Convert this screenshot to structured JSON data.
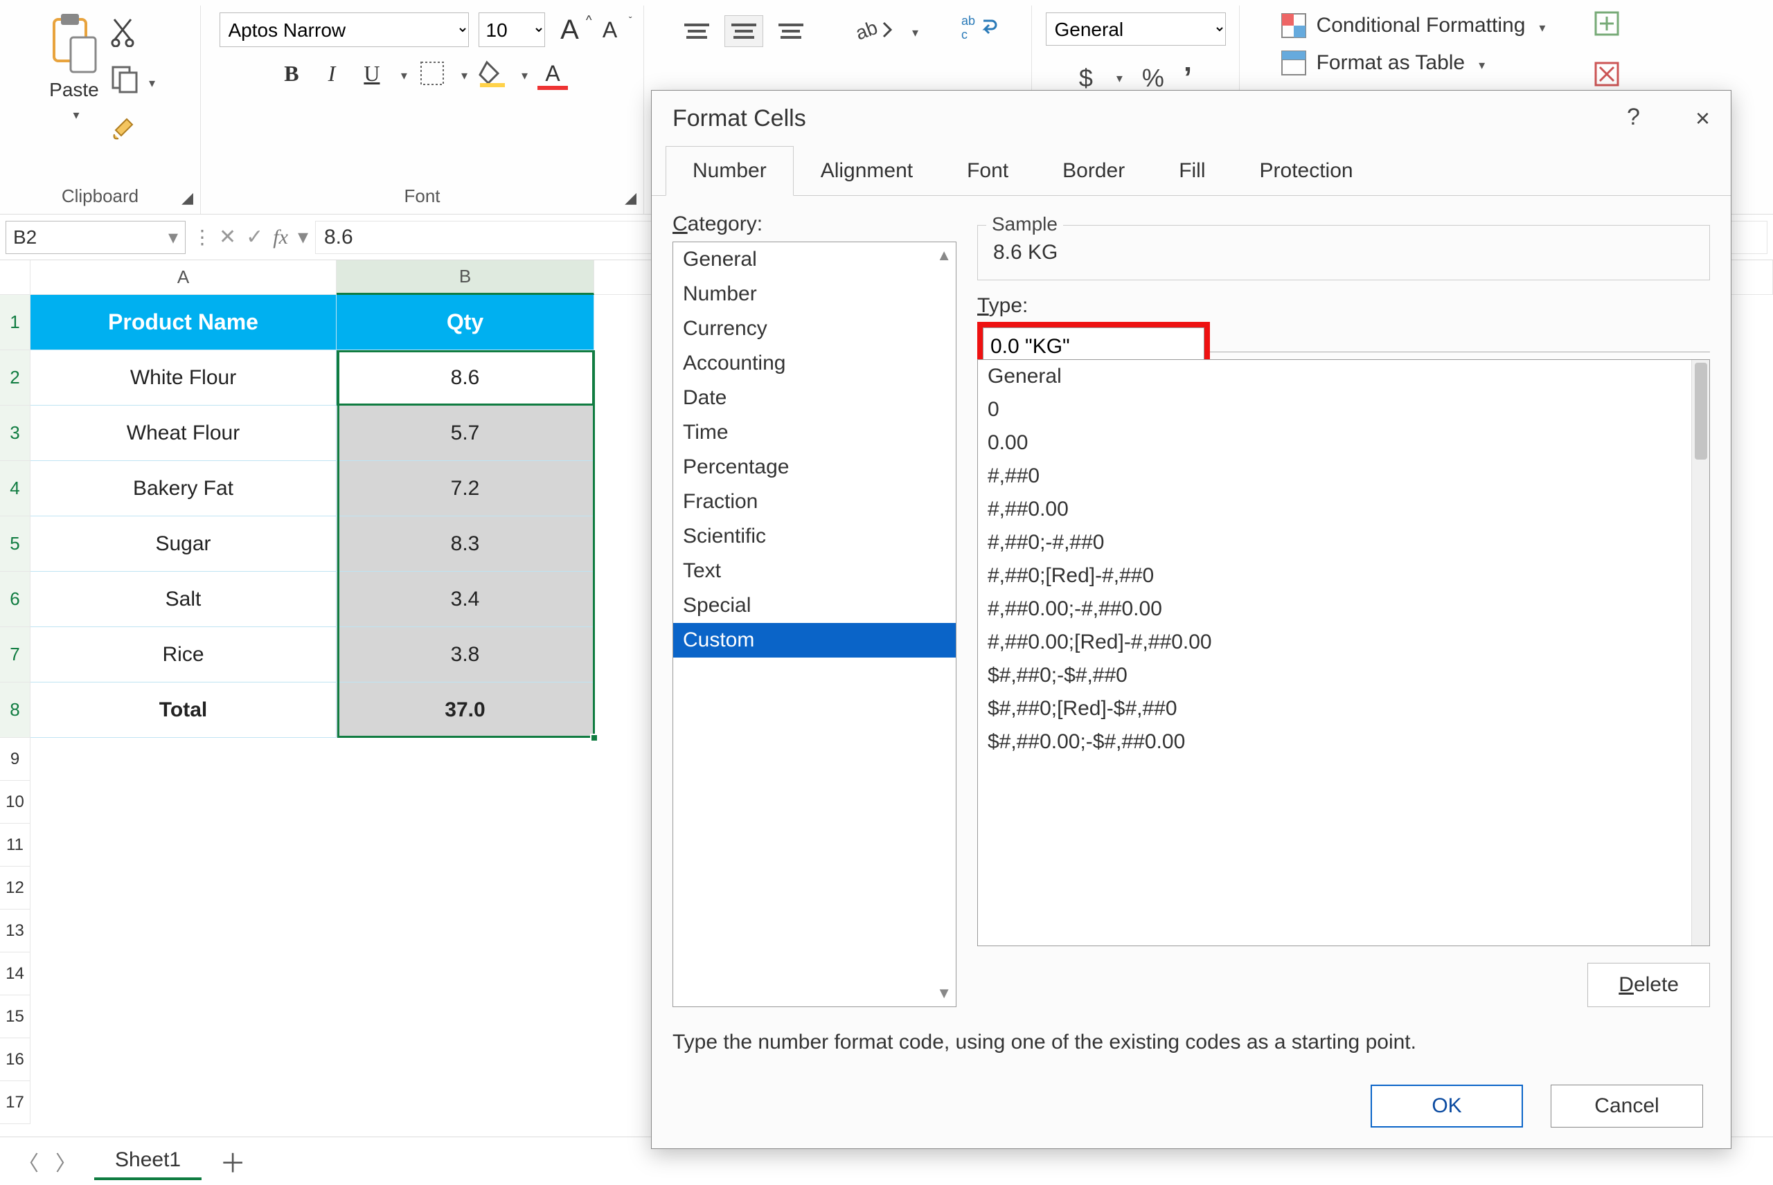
{
  "ribbon": {
    "clipboard": {
      "paste": "Paste",
      "group_label": "Clipboard"
    },
    "font": {
      "name": "Aptos Narrow",
      "size": "10",
      "grow": "A",
      "shrink": "A",
      "bold": "B",
      "italic": "I",
      "underline": "U",
      "group_label": "Font"
    },
    "number": {
      "format": "General",
      "currency": "$",
      "percent": "%",
      "comma": ","
    },
    "styles": {
      "conditional": "Conditional Formatting",
      "table": "Format as Table"
    }
  },
  "formula_bar": {
    "cell_ref": "B2",
    "fx": "fx",
    "value": "8.6"
  },
  "sheet": {
    "columns": [
      "A",
      "B"
    ],
    "header": {
      "A": "Product Name",
      "B": "Qty"
    },
    "rows": [
      {
        "A": "White Flour",
        "B": "8.6"
      },
      {
        "A": "Wheat Flour",
        "B": "5.7"
      },
      {
        "A": "Bakery Fat",
        "B": "7.2"
      },
      {
        "A": "Sugar",
        "B": "8.3"
      },
      {
        "A": "Salt",
        "B": "3.4"
      },
      {
        "A": "Rice",
        "B": "3.8"
      }
    ],
    "total": {
      "A": "Total",
      "B": "37.0"
    },
    "row_labels": [
      "1",
      "2",
      "3",
      "4",
      "5",
      "6",
      "7",
      "8",
      "9",
      "10",
      "11",
      "12",
      "13",
      "14",
      "15",
      "16",
      "17"
    ]
  },
  "tabs": {
    "sheet1": "Sheet1"
  },
  "dialog": {
    "title": "Format Cells",
    "help": "?",
    "close": "×",
    "tabs": [
      "Number",
      "Alignment",
      "Font",
      "Border",
      "Fill",
      "Protection"
    ],
    "active_tab": "Number",
    "category_label_pre": "C",
    "category_label_post": "ategory:",
    "categories": [
      "General",
      "Number",
      "Currency",
      "Accounting",
      "Date",
      "Time",
      "Percentage",
      "Fraction",
      "Scientific",
      "Text",
      "Special",
      "Custom"
    ],
    "selected_category": "Custom",
    "sample_label": "Sample",
    "sample_value": "8.6 KG",
    "type_label_pre": "T",
    "type_label_post": "ype:",
    "type_value": "0.0 \"KG\"",
    "format_codes": [
      "General",
      "0",
      "0.00",
      "#,##0",
      "#,##0.00",
      "#,##0;-#,##0",
      "#,##0;[Red]-#,##0",
      "#,##0.00;-#,##0.00",
      "#,##0.00;[Red]-#,##0.00",
      "$#,##0;-$#,##0",
      "$#,##0;[Red]-$#,##0",
      "$#,##0.00;-$#,##0.00"
    ],
    "delete_pre": "D",
    "delete_post": "elete",
    "hint": "Type the number format code, using one of the existing codes as a starting point.",
    "ok": "OK",
    "cancel": "Cancel"
  }
}
